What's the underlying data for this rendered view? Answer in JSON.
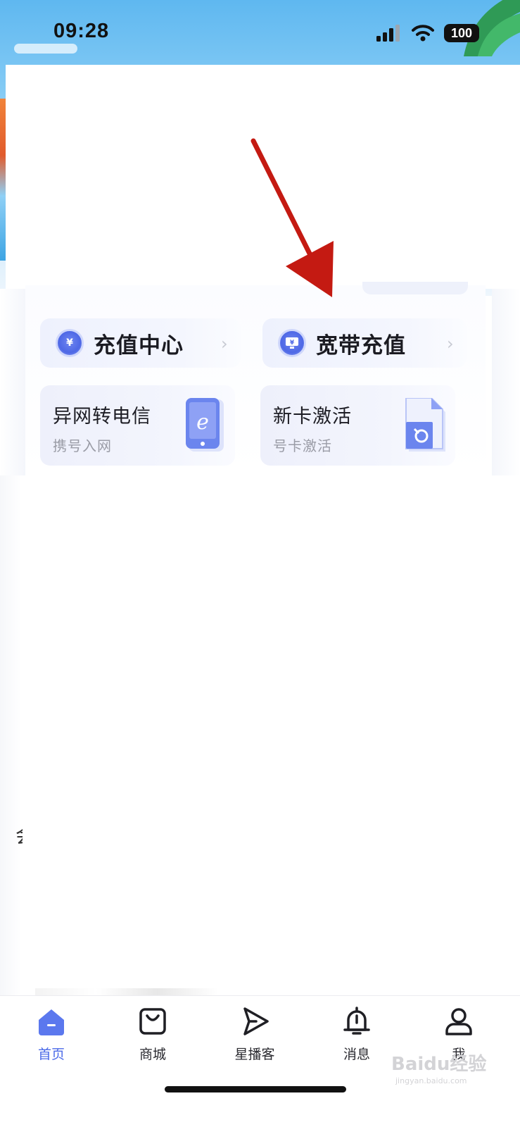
{
  "status_bar": {
    "time": "09:28",
    "battery": "100"
  },
  "quick_actions": [
    {
      "label": "充值中心",
      "icon": "yen-coin-icon"
    },
    {
      "label": "宽带充值",
      "icon": "broadband-yen-icon"
    }
  ],
  "services": [
    {
      "title": "异网转电信",
      "subtitle": "携号入网",
      "icon": "phone-telecom-icon"
    },
    {
      "title": "新卡激活",
      "subtitle": "号卡激活",
      "icon": "sim-card-icon"
    }
  ],
  "tab_bar": [
    {
      "label": "首页",
      "icon": "home-icon",
      "active": true
    },
    {
      "label": "商城",
      "icon": "shop-bag-icon",
      "active": false
    },
    {
      "label": "星播客",
      "icon": "play-arrow-icon",
      "active": false
    },
    {
      "label": "消息",
      "icon": "bell-icon",
      "active": false
    },
    {
      "label": "我",
      "icon": "user-icon",
      "active": false
    }
  ],
  "watermark": {
    "text": "Baidu经验",
    "sub": "jingyan.baidu.com"
  },
  "colors": {
    "accent": "#4b6ae8",
    "annotation_arrow": "#c41a12"
  }
}
